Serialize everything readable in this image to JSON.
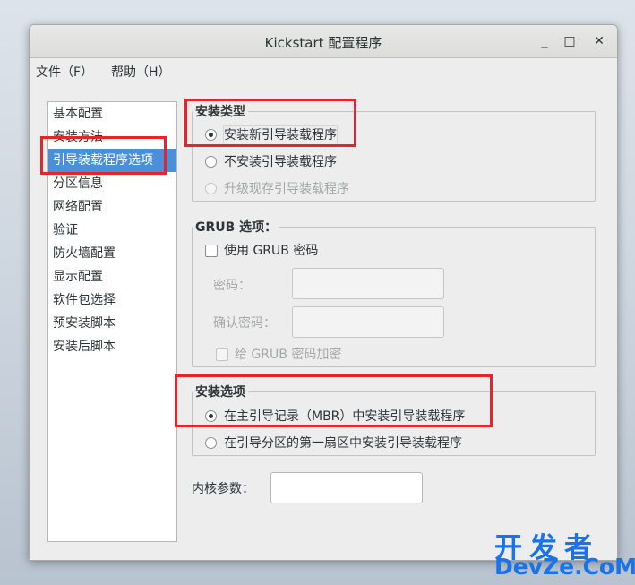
{
  "window": {
    "title": "Kickstart 配置程序"
  },
  "titlebar": {
    "minimize_glyph": "_",
    "maximize_glyph": "□",
    "close_glyph": "✕"
  },
  "menubar": {
    "file": "文件（F）",
    "help": "帮助（H）"
  },
  "nav": {
    "items": [
      "基本配置",
      "安装方法",
      "引导装载程序选项",
      "分区信息",
      "网络配置",
      "验证",
      "防火墙配置",
      "显示配置",
      "软件包选择",
      "预安装脚本",
      "安装后脚本"
    ],
    "selected_index": 2
  },
  "install_type": {
    "title": "安装类型",
    "options": [
      "安装新引导装载程序",
      "不安装引导装载程序",
      "升级现存引导装载程序"
    ],
    "selected_index": 0
  },
  "grub": {
    "title": "GRUB 选项：",
    "use_password_label": "使用 GRUB 密码",
    "use_password_checked": false,
    "password_label": "密码：",
    "password_value": "",
    "confirm_label": "确认密码：",
    "confirm_value": "",
    "encrypt_label": "给 GRUB 密码加密",
    "encrypt_checked": false
  },
  "install_options": {
    "title": "安装选项",
    "options": [
      "在主引导记录（MBR）中安装引导装载程序",
      "在引导分区的第一扇区中安装引导装载程序"
    ],
    "selected_index": 0
  },
  "kernel": {
    "label": "内核参数：",
    "value": ""
  },
  "watermark": {
    "top": "开发者",
    "bottom": "DevZe.CoM"
  },
  "colors": {
    "highlight": "#e8232a",
    "selection": "#4a90d9",
    "watermark": "#1a73e8"
  }
}
